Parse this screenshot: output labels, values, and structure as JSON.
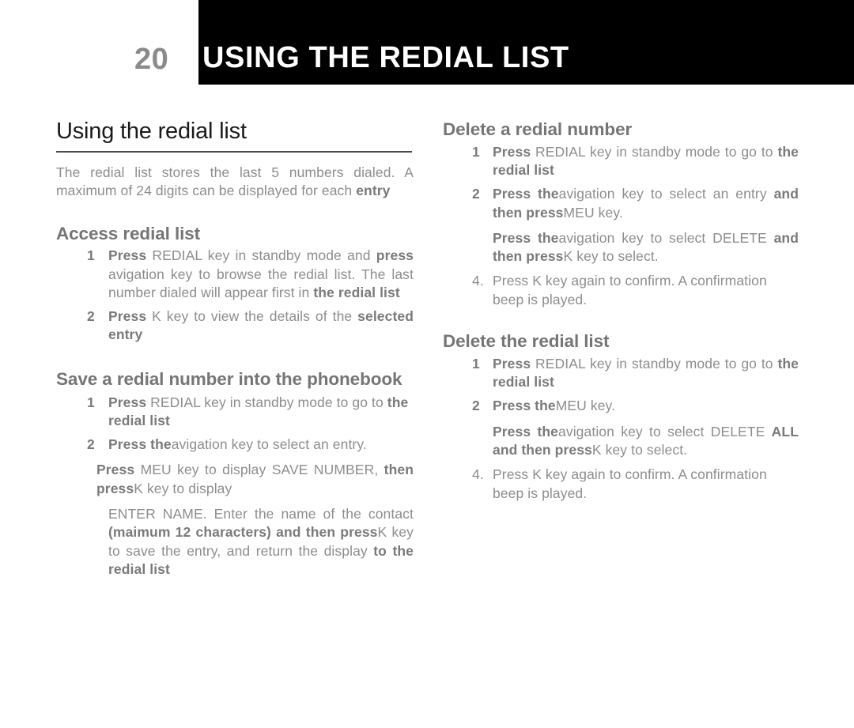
{
  "header": {
    "chapter_number": "20",
    "chapter_title": "USING THE REDIAL LIST",
    "band_color": "#000000",
    "number_color": "#8a8a8a",
    "title_color": "#ffffff"
  },
  "left_column": {
    "page_title": "Using the redial list",
    "intro": {
      "normal": "The redial list stores the last 5 numbers dialed. A maximum of 24 digits can be displayed for each ",
      "bold": "entry"
    },
    "access_section": {
      "heading": "Access redial list",
      "steps": [
        {
          "marker": "1",
          "parts": [
            {
              "text": "Press ",
              "bold": true
            },
            {
              "text": "REDIAL  key in standby mode and ",
              "bold": false
            },
            {
              "text": "press ",
              "bold": true
            },
            {
              "text": "avigation    key to browse the redial list. The last number dialed will appear first in ",
              "bold": false
            },
            {
              "text": "the redial list",
              "bold": true
            }
          ]
        },
        {
          "marker": "2",
          "parts": [
            {
              "text": "Press ",
              "bold": true
            },
            {
              "text": "K    key to view the details of the ",
              "bold": false
            },
            {
              "text": "selected entry",
              "bold": true
            }
          ]
        }
      ]
    },
    "save_section": {
      "heading": "Save a redial number into the phonebook",
      "steps": [
        {
          "marker": "1",
          "parts": [
            {
              "text": "Press ",
              "bold": true
            },
            {
              "text": "REDIAL key in standby mode to go to ",
              "bold": false
            },
            {
              "text": "the redial list",
              "bold": true
            }
          ]
        },
        {
          "marker": "2",
          "parts": [
            {
              "text": "Press the",
              "bold": true
            },
            {
              "text": "avigation    key to select an entry.",
              "bold": false
            }
          ]
        }
      ],
      "continuation_1": [
        {
          "text": "Press ",
          "bold": true
        },
        {
          "text": " MEU   key to display SAVE NUMBER, ",
          "bold": false
        },
        {
          "text": "then press",
          "bold": true
        },
        {
          "text": "K   key to display",
          "bold": false
        }
      ],
      "continuation_2": [
        {
          "text": "ENTER NAME. Enter the name of the contact ",
          "bold": false
        },
        {
          "text": "(maimum 12 characters) and then press",
          "bold": true
        },
        {
          "text": "K key to save the entry, and return the display ",
          "bold": false
        },
        {
          "text": "to the redial list",
          "bold": true
        }
      ]
    }
  },
  "right_column": {
    "delete_number_section": {
      "heading": "Delete a redial number",
      "steps": [
        {
          "marker": "1",
          "parts": [
            {
              "text": "Press ",
              "bold": true
            },
            {
              "text": "REDIAL key in standby mode to go to ",
              "bold": false
            },
            {
              "text": "the redial list",
              "bold": true
            }
          ]
        },
        {
          "marker": "2",
          "parts": [
            {
              "text": "Press the",
              "bold": true
            },
            {
              "text": "avigation    key to select an entry ",
              "bold": false
            },
            {
              "text": "and then press",
              "bold": true
            },
            {
              "text": "MEU   key.",
              "bold": false
            }
          ]
        }
      ],
      "continuation": [
        {
          "text": "Press the",
          "bold": true
        },
        {
          "text": "avigation    key to select DELETE ",
          "bold": false
        },
        {
          "text": "and then press",
          "bold": true
        },
        {
          "text": "K   key to select.",
          "bold": false
        }
      ],
      "final_step": {
        "marker": "4.",
        "parts": [
          {
            "text": "Press K   key again to confirm. A confirmation beep is played.",
            "bold": false
          }
        ]
      }
    },
    "delete_list_section": {
      "heading": "Delete the redial list",
      "steps": [
        {
          "marker": "1",
          "parts": [
            {
              "text": "Press ",
              "bold": true
            },
            {
              "text": "REDIAL key in standby mode to go to ",
              "bold": false
            },
            {
              "text": "the redial list",
              "bold": true
            }
          ]
        },
        {
          "marker": "2",
          "parts": [
            {
              "text": "Press the",
              "bold": true
            },
            {
              "text": "MEU   key.",
              "bold": false
            }
          ]
        }
      ],
      "continuation": [
        {
          "text": "Press the",
          "bold": true
        },
        {
          "text": "avigation    key to select DELETE ",
          "bold": false
        },
        {
          "text": "ALL and then press",
          "bold": true
        },
        {
          "text": "K   key to select.",
          "bold": false
        }
      ],
      "final_step": {
        "marker": "4.",
        "parts": [
          {
            "text": "Press K   key again to confirm. A confirmation beep is played.",
            "bold": false
          }
        ]
      }
    }
  }
}
